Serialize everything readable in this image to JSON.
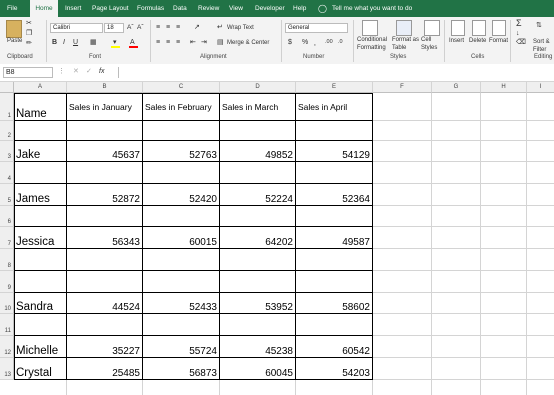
{
  "menu": {
    "items": [
      "File",
      "Home",
      "Insert",
      "Page Layout",
      "Formulas",
      "Data",
      "Review",
      "View",
      "Developer",
      "Help"
    ],
    "tell_me": "Tell me what you want to do"
  },
  "ribbon": {
    "paste": "Paste",
    "font_name": "Calibri",
    "font_size": "18",
    "wrap_text": "Wrap Text",
    "merge_center": "Merge & Center",
    "number_format": "General",
    "conditional_formatting": "Conditional Formatting",
    "format_as_table": "Format as Table",
    "cell_styles": "Cell Styles",
    "insert": "Insert",
    "delete": "Delete",
    "format": "Format",
    "sort_filter": "Sort & Filter",
    "groups": {
      "clipboard": "Clipboard",
      "font": "Font",
      "alignment": "Alignment",
      "number": "Number",
      "styles": "Styles",
      "cells": "Cells",
      "editing": "Editing"
    }
  },
  "formula_bar": {
    "name_box": "B8",
    "fx": "fx",
    "formula": ""
  },
  "columns": [
    "A",
    "B",
    "C",
    "D",
    "E",
    "F",
    "G",
    "H",
    "I"
  ],
  "rows": [
    "1",
    "2",
    "3",
    "4",
    "5",
    "6",
    "7",
    "8",
    "9",
    "10",
    "11",
    "12",
    "13"
  ],
  "table": {
    "headers": [
      "Name",
      "Sales in January",
      "Sales in February",
      "Sales in March",
      "Sales in April"
    ],
    "records": [
      {
        "row": "3",
        "name": "Jake",
        "values": [
          "45637",
          "52763",
          "49852",
          "54129"
        ]
      },
      {
        "row": "5",
        "name": "James",
        "values": [
          "52872",
          "52420",
          "52224",
          "52364"
        ]
      },
      {
        "row": "7",
        "name": "Jessica",
        "values": [
          "56343",
          "60015",
          "64202",
          "49587"
        ]
      },
      {
        "row": "10",
        "name": "Sandra",
        "values": [
          "44524",
          "52433",
          "53952",
          "58602"
        ]
      },
      {
        "row": "12",
        "name": "Michelle",
        "values": [
          "35227",
          "55724",
          "45238",
          "60542"
        ]
      },
      {
        "row": "13",
        "name": "Crystal",
        "values": [
          "25485",
          "56873",
          "60045",
          "54203"
        ]
      }
    ]
  },
  "colors": {
    "accent": "#217346",
    "grid_line": "#d4d4d4",
    "cell_border": "#000000"
  }
}
